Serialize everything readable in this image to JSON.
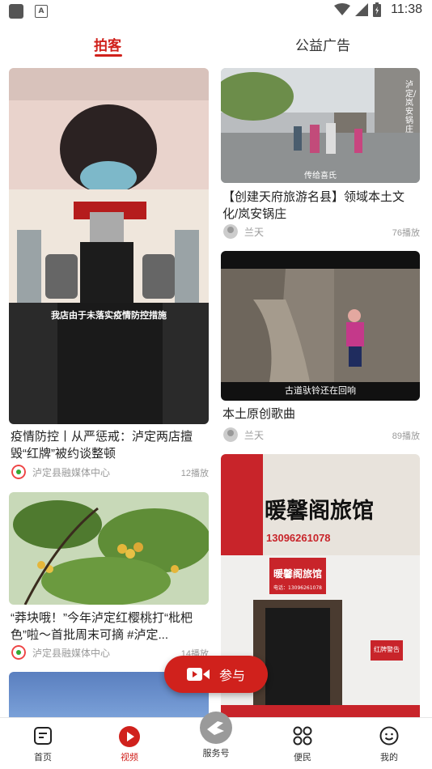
{
  "status": {
    "time": "11:38"
  },
  "tabs": [
    {
      "label": "拍客",
      "active": true
    },
    {
      "label": "公益广告",
      "active": false
    }
  ],
  "cards": [
    {
      "title": "疫情防控丨从严惩戒：泸定两店擅毁“红牌”被约谈整顿",
      "source": "泸定县融媒体中心",
      "plays": "12播放",
      "caption": "我店由于未落实疫情防控措施"
    },
    {
      "title": "【创建天府旅游名县】领域本土文化/岚安锅庄",
      "source": "兰天",
      "plays": "76播放",
      "caption": "传给喜氏",
      "side_text": "泸定/岚安锅庄"
    },
    {
      "title": "本土原创歌曲",
      "source": "兰天",
      "plays": "89播放",
      "caption": "古道驮铃还在回响"
    },
    {
      "title": "“莽块哦！”今年泸定红樱桃打“枇杷色”啦～首批周末可摘 #泸定...",
      "source": "泸定县融媒体中心",
      "plays": "14播放"
    },
    {
      "sign_text": "暖馨阁旅馆",
      "sign_small": "暖馨阁旅馆",
      "phone": "电话：13096261078",
      "phone_top": "13096261078",
      "notice": "红牌警告"
    }
  ],
  "fab": {
    "label": "参与"
  },
  "nav": [
    {
      "label": "首页",
      "icon": "home-icon"
    },
    {
      "label": "视频",
      "icon": "video-play-icon",
      "active": true
    },
    {
      "label": "服务号",
      "icon": "service-icon"
    },
    {
      "label": "便民",
      "icon": "grid-icon"
    },
    {
      "label": "我的",
      "icon": "profile-icon"
    }
  ],
  "colors": {
    "accent": "#d0211c"
  }
}
